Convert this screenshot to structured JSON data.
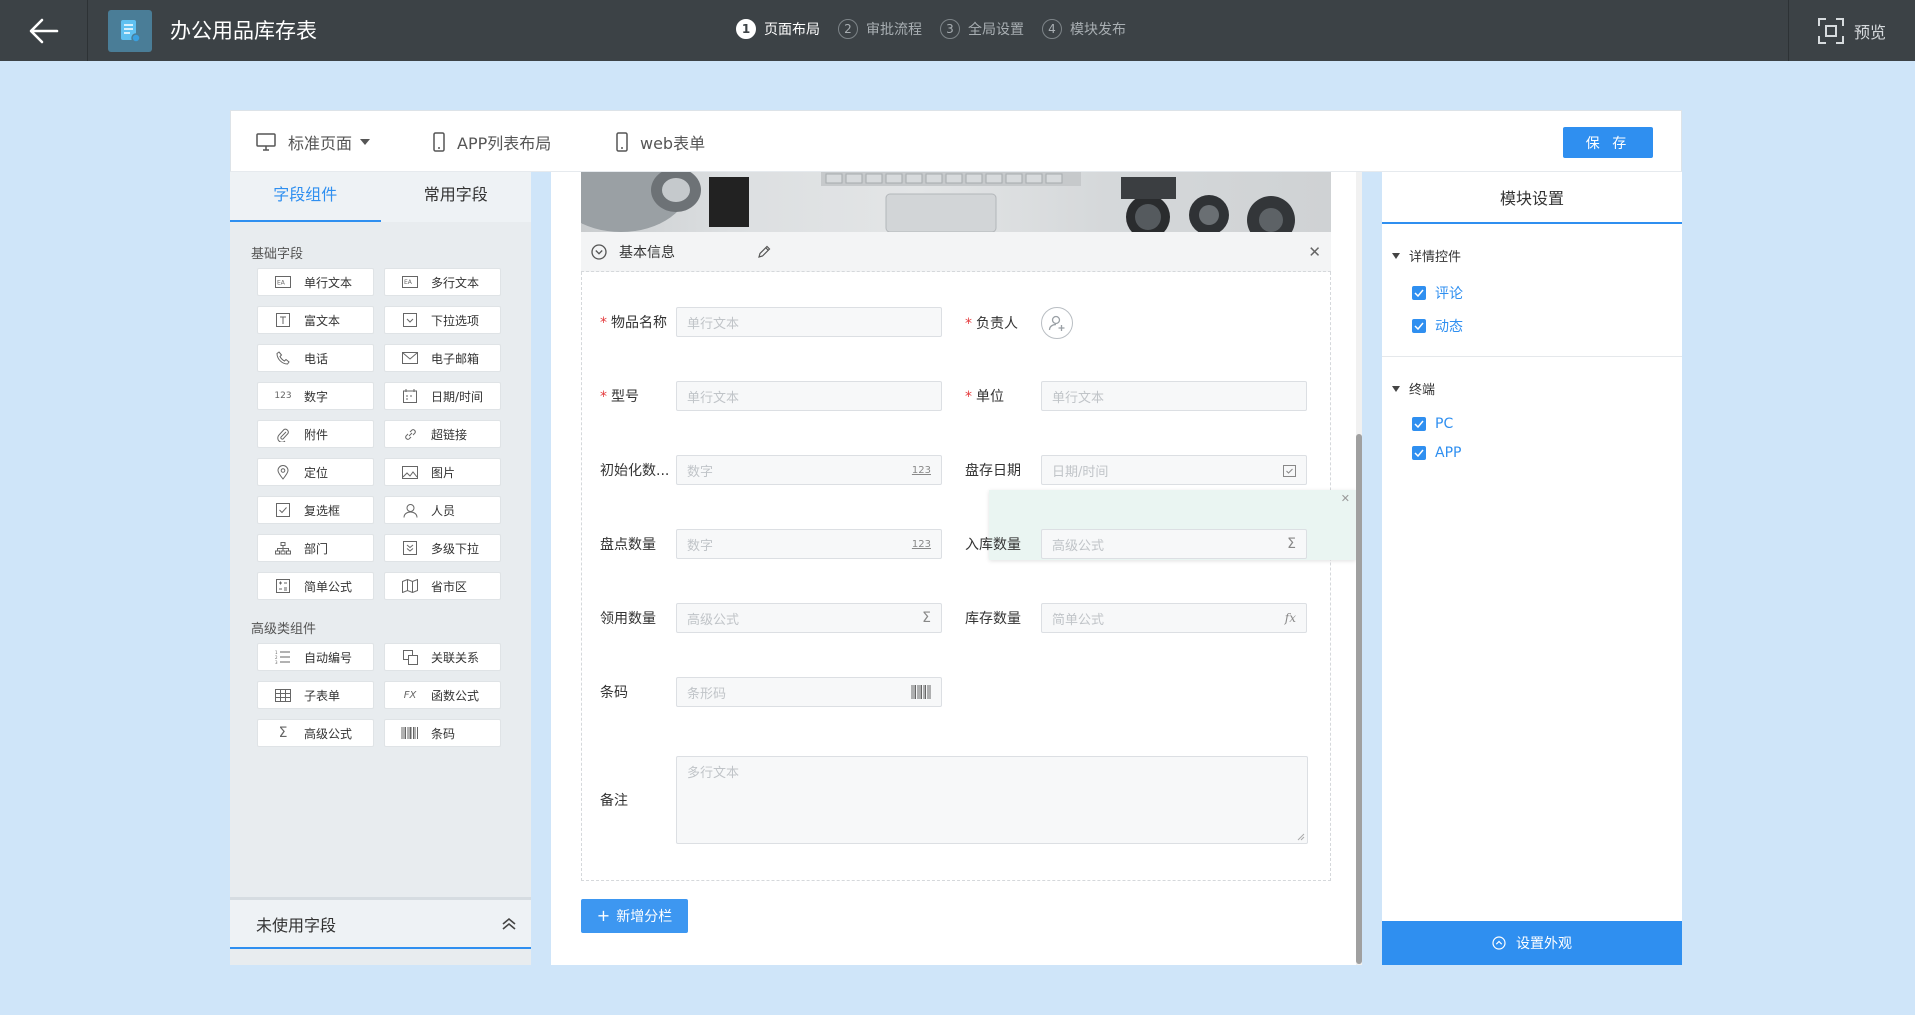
{
  "header": {
    "title": "办公用品库存表",
    "steps": [
      {
        "num": "1",
        "label": "页面布局"
      },
      {
        "num": "2",
        "label": "审批流程"
      },
      {
        "num": "3",
        "label": "全局设置"
      },
      {
        "num": "4",
        "label": "模块发布"
      }
    ],
    "preview_label": "预览"
  },
  "toolbar": {
    "layout_select": "标准页面",
    "app_list_layout": "APP列表布局",
    "web_form": "web表单",
    "save_label": "保 存"
  },
  "left_panel": {
    "tabs": [
      "字段组件",
      "常用字段"
    ],
    "basic_group_title": "基础字段",
    "basic_fields": [
      "单行文本",
      "多行文本",
      "富文本",
      "下拉选项",
      "电话",
      "电子邮箱",
      "数字",
      "日期/时间",
      "附件",
      "超链接",
      "定位",
      "图片",
      "复选框",
      "人员",
      "部门",
      "多级下拉",
      "简单公式",
      "省市区"
    ],
    "advanced_group_title": "高级类组件",
    "advanced_fields": [
      "自动编号",
      "关联关系",
      "子表单",
      "函数公式",
      "高级公式",
      "条码"
    ],
    "unused_title": "未使用字段"
  },
  "form": {
    "section_title": "基本信息",
    "fields": {
      "item_name": {
        "label": "物品名称",
        "placeholder": "单行文本"
      },
      "owner": {
        "label": "负责人"
      },
      "model": {
        "label": "型号",
        "placeholder": "单行文本"
      },
      "unit": {
        "label": "单位",
        "placeholder": "单行文本"
      },
      "init_qty": {
        "label": "初始化数...",
        "placeholder": "数字",
        "icon": "123"
      },
      "count_date": {
        "label": "盘存日期",
        "placeholder": "日期/时间"
      },
      "count_qty": {
        "label": "盘点数量",
        "placeholder": "数字",
        "icon": "123"
      },
      "in_qty": {
        "label": "入库数量",
        "placeholder": "高级公式"
      },
      "use_qty": {
        "label": "领用数量",
        "placeholder": "高级公式"
      },
      "stock_qty": {
        "label": "库存数量",
        "placeholder": "简单公式",
        "icon": "fx"
      },
      "barcode": {
        "label": "条码",
        "placeholder": "条形码"
      },
      "remark": {
        "label": "备注",
        "placeholder": "多行文本"
      }
    },
    "add_column_label": "新增分栏"
  },
  "right_panel": {
    "title": "模块设置",
    "detail_group": "详情控件",
    "detail_items": [
      "评论",
      "动态"
    ],
    "terminal_group": "终端",
    "terminal_items": [
      "PC",
      "APP"
    ],
    "appearance_label": "设置外观"
  },
  "colors": {
    "accent": "#2f8ff0",
    "header_bg": "#3c4246",
    "page_bg": "#cfe5f9",
    "required": "#e4393c"
  }
}
